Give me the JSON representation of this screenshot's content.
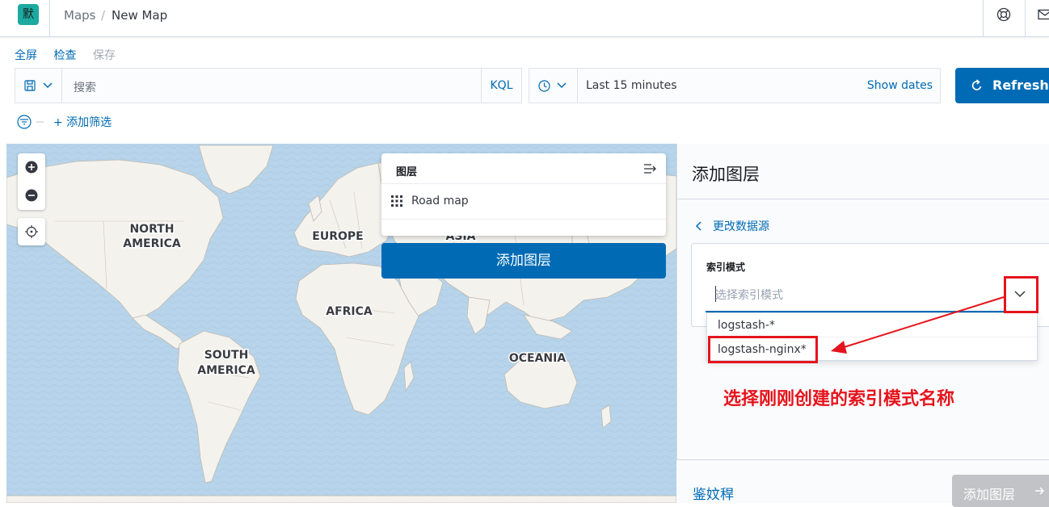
{
  "header": {
    "logo_char": "默",
    "breadcrumb_app": "Maps",
    "breadcrumb_sep": "/",
    "breadcrumb_page": "New Map",
    "icons": [
      "help-icon",
      "mail-icon"
    ]
  },
  "toolbar": {
    "fullscreen": "全屏",
    "inspect": "检查",
    "save": "保存"
  },
  "query": {
    "placeholder": "搜索",
    "language": "KQL",
    "time_range": "Last 15 minutes",
    "show_dates": "Show dates",
    "refresh": "Refresh"
  },
  "filters": {
    "add_filter": "+ 添加筛选"
  },
  "map": {
    "labels": {
      "north_america_1": "NORTH",
      "north_america_2": "AMERICA",
      "europe": "EUROPE",
      "asia": "ASIA",
      "africa": "AFRICA",
      "south_america_1": "SOUTH",
      "south_america_2": "AMERICA",
      "oceania": "OCEANIA"
    },
    "colors": {
      "water": "#b7d4ea",
      "land": "#f4f2ed",
      "border": "#bfbab0"
    }
  },
  "layers_panel": {
    "title": "图层",
    "items": [
      {
        "label": "Road map"
      }
    ],
    "add_layer_button": "添加图层"
  },
  "add_layer_flyout": {
    "title": "添加图层",
    "back_link": "更改数据源",
    "index_pattern_label": "索引模式",
    "index_pattern_placeholder": "选择索引模式",
    "options": [
      "logstash-*",
      "logstash-nginx*"
    ],
    "cancel": "鉴妏稈",
    "add_button": "添加图层"
  },
  "annotation": {
    "text": "选择刚刚创建的索引模式名称",
    "color": "#e5141c"
  },
  "theme": {
    "primary": "#006bb4",
    "logo_bg": "#1ba9a0"
  }
}
